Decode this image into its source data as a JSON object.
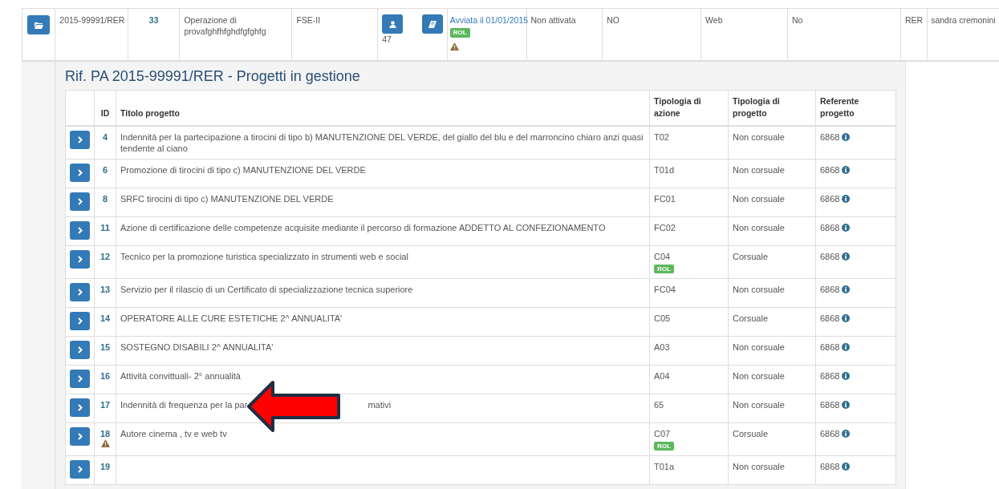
{
  "operation_row": {
    "code": "2015-99991/RER",
    "number": "33",
    "title": "Operazione di provafghfhfghdfgfghfg",
    "fund": "FSE-II",
    "count": "47",
    "status": "Avviata il 01/01/2015",
    "status_badge": "ROL",
    "warning": true,
    "activation": "Non attivata",
    "flag": "NO",
    "channel": "Web",
    "option": "No",
    "region": "RER",
    "owner": "sandra cremonini"
  },
  "panel": {
    "title": "Rif. PA 2015-99991/RER - Progetti in gestione"
  },
  "table": {
    "columns": [
      "ID",
      "Titolo progetto",
      "Tipologia di azione",
      "Tipologia di progetto",
      "Referente progetto"
    ],
    "rows": [
      {
        "id": "4",
        "title": [
          "Indennità per la partecipazione a tirocini di tipo b) MANUTENZIONE DEL VERDE, del giallo del blu e del marroncino chiaro anzi quasi tendente al ciano"
        ],
        "warning": false,
        "action_type": "T02",
        "project_type": "Non corsuale",
        "referent": "6868"
      },
      {
        "id": "6",
        "title": [
          "Promozione di tirocini di tipo c) MANUTENZIONE DEL VERDE"
        ],
        "warning": false,
        "action_type": "T01d",
        "project_type": "Non corsuale",
        "referent": "6868"
      },
      {
        "id": "8",
        "title": [
          "SRFC tirocini di tipo c) MANUTENZIONE DEL VERDE"
        ],
        "warning": false,
        "action_type": "FC01",
        "project_type": "Non corsuale",
        "referent": "6868"
      },
      {
        "id": "11",
        "title": [
          "Azione di certificazione delle competenze acquisite mediante il percorso di formazione ADDETTO AL CONFEZIONAMENTO"
        ],
        "warning": false,
        "action_type": "FC02",
        "project_type": "Non corsuale",
        "referent": "6868"
      },
      {
        "id": "12",
        "title": [
          "Tecnico per la promozione turistica specializzato in strumenti web e social"
        ],
        "warning": false,
        "action_type": "C04",
        "badge": "ROL",
        "project_type": "Corsuale",
        "referent": "6868"
      },
      {
        "id": "13",
        "title": [
          "Servizio per il rilascio di un Certificato di specializzazione tecnica superiore"
        ],
        "warning": false,
        "action_type": "FC04",
        "project_type": "Non corsuale",
        "referent": "6868"
      },
      {
        "id": "14",
        "title": [
          "OPERATORE ALLE CURE ESTETICHE 2^ ANNUALITA'"
        ],
        "warning": false,
        "action_type": "C05",
        "project_type": "Corsuale",
        "referent": "6868"
      },
      {
        "id": "15",
        "title": [
          "SOSTEGNO DISABILI 2^ ANNUALITA'"
        ],
        "warning": false,
        "action_type": "A03",
        "project_type": "Non corsuale",
        "referent": "6868"
      },
      {
        "id": "16",
        "title": [
          "Attività convittuali- 2° annualità"
        ],
        "warning": false,
        "action_type": "A04",
        "project_type": "Non corsuale",
        "referent": "6868"
      },
      {
        "id": "17",
        "title": [
          "Indennità di frequenza per la par",
          "mativi"
        ],
        "warning": false,
        "action_type": "65",
        "project_type": "Non corsuale",
        "referent": "6868",
        "arrow": true
      },
      {
        "id": "18",
        "title": [
          "Autore cinema , tv e web tv"
        ],
        "warning": true,
        "action_type": "C07",
        "badge": "ROL",
        "project_type": "Corsuale",
        "referent": "6868"
      },
      {
        "id": "19",
        "warning": false,
        "action_type": "T01a",
        "project_type": "Non corsuale",
        "referent": "6868"
      }
    ]
  }
}
